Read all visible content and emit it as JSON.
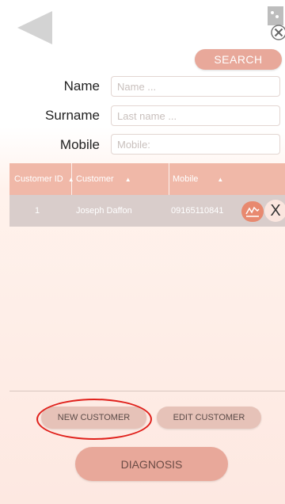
{
  "toolbar": {
    "back_icon": "back-arrow-icon",
    "close_icon": "close-circle-icon"
  },
  "search": {
    "label": "SEARCH"
  },
  "form": {
    "name": {
      "label": "Name",
      "placeholder": "Name ...",
      "value": ""
    },
    "surname": {
      "label": "Surname",
      "placeholder": "Last name ...",
      "value": ""
    },
    "mobile": {
      "label": "Mobile",
      "placeholder": "Mobile:",
      "value": ""
    }
  },
  "table": {
    "headers": [
      "Customer ID",
      "Customer",
      "Mobile"
    ],
    "sort_icon": "sort-up-icon",
    "rows": [
      {
        "id": "1",
        "customer": "Joseph Daffon",
        "mobile": "09165110841",
        "chart_icon": "chart-icon",
        "delete_label": "X"
      }
    ]
  },
  "buttons": {
    "new_customer": "NEW CUSTOMER",
    "edit_customer": "EDIT CUSTOMER",
    "diagnosis": "DIAGNOSIS"
  },
  "colors": {
    "accent": "#e8a89a",
    "header": "#f0b8a8",
    "selected_row": "#d9cdcb",
    "highlight": "#e0201b"
  }
}
